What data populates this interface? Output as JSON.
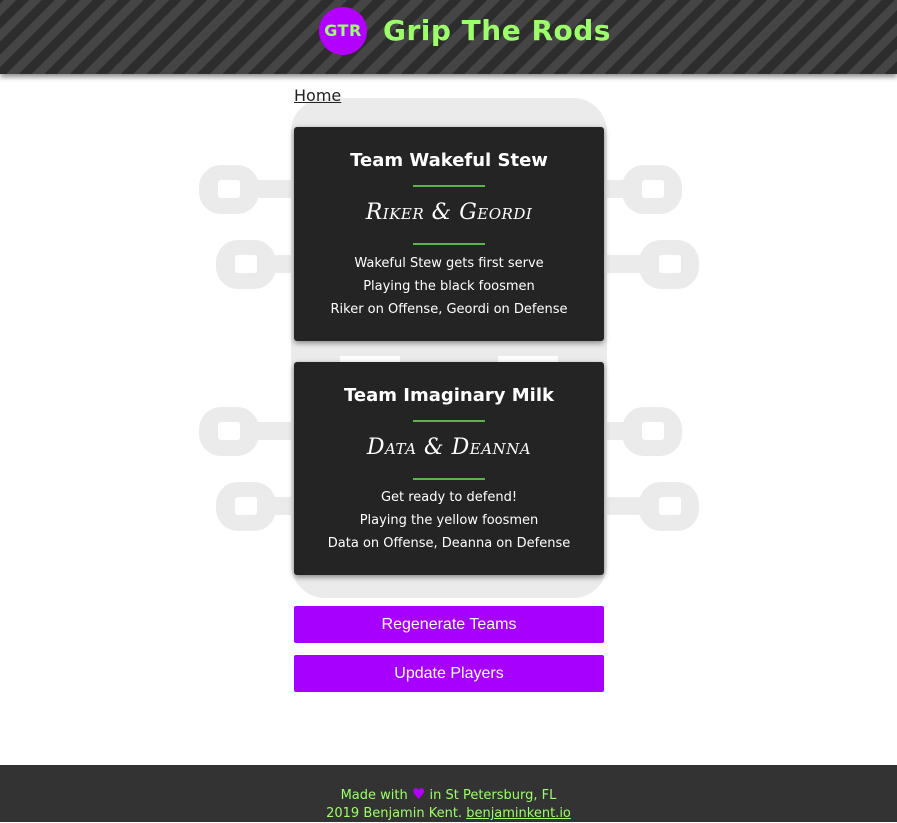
{
  "header": {
    "logo_text": "GTR",
    "title": "Grip The Rods"
  },
  "nav": {
    "home_label": "Home"
  },
  "teams": [
    {
      "name": "Team Wakeful Stew",
      "players": "Riker & Geordi",
      "serve_text": "Wakeful Stew gets first serve",
      "color_text": "Playing the black foosmen",
      "positions_text": "Riker on Offense, Geordi on Defense"
    },
    {
      "name": "Team Imaginary Milk",
      "players": "Data & Deanna",
      "serve_text": "Get ready to defend!",
      "color_text": "Playing the yellow foosmen",
      "positions_text": "Data on Offense, Deanna on Defense"
    }
  ],
  "actions": {
    "regenerate_label": "Regenerate Teams",
    "update_label": "Update Players"
  },
  "footer": {
    "made_with": "Made with",
    "heart_icon": "heart-icon",
    "location": "in St Petersburg, FL",
    "copyright": "2019 Benjamin Kent.",
    "link_text": "benjaminkent.io"
  },
  "colors": {
    "accent_purple": "#a800ff",
    "accent_green": "#9cff6a",
    "divider_green": "#5ab447",
    "card_bg": "#242424"
  }
}
